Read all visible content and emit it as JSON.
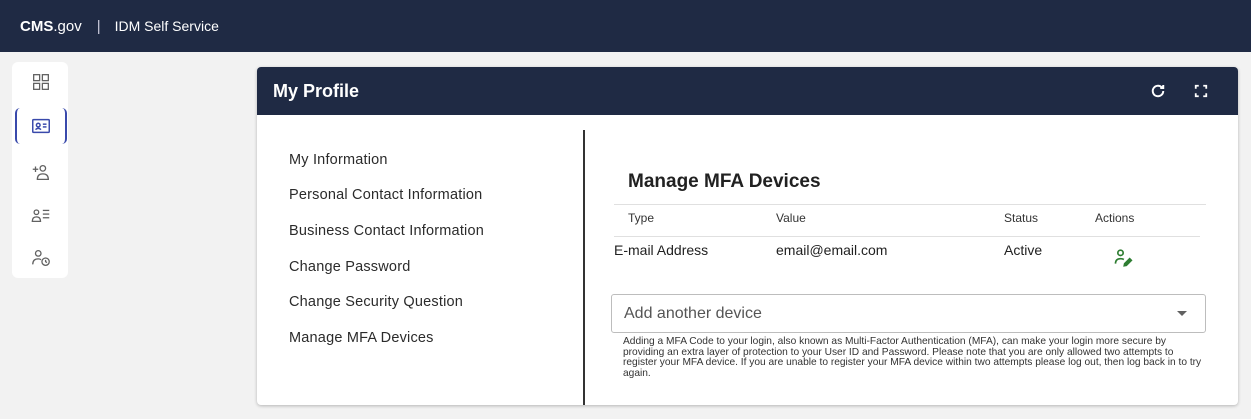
{
  "topbar": {
    "brand_bold": "CMS",
    "brand_rest": ".gov",
    "separator": "|",
    "app_title": "IDM Self Service"
  },
  "rail": {
    "items": [
      "dashboard-icon",
      "profile-card-icon",
      "add-user-icon",
      "user-list-icon",
      "user-history-icon"
    ]
  },
  "card": {
    "title": "My Profile"
  },
  "nav": {
    "items": [
      "My Information",
      "Personal Contact Information",
      "Business Contact Information",
      "Change Password",
      "Change Security Question",
      "Manage MFA Devices"
    ]
  },
  "mfa": {
    "title": "Manage MFA Devices",
    "columns": [
      "Type",
      "Value",
      "Status",
      "Actions"
    ],
    "rows": [
      {
        "type": "E-mail Address",
        "value": "email@email.com",
        "status": "Active"
      }
    ],
    "add_placeholder": "Add another device",
    "help_text": "Adding a MFA Code to your login, also known as Multi-Factor Authentication (MFA), can make your login more secure by providing an extra layer of protection to your User ID and Password. Please note that you are only allowed two attempts to register your MFA device. If you are unable to register your MFA device within two attempts please log out, then log back in to try again."
  },
  "colors": {
    "navy": "#1f2a44",
    "accent": "#3949ab",
    "action_green": "#2e7d32"
  }
}
